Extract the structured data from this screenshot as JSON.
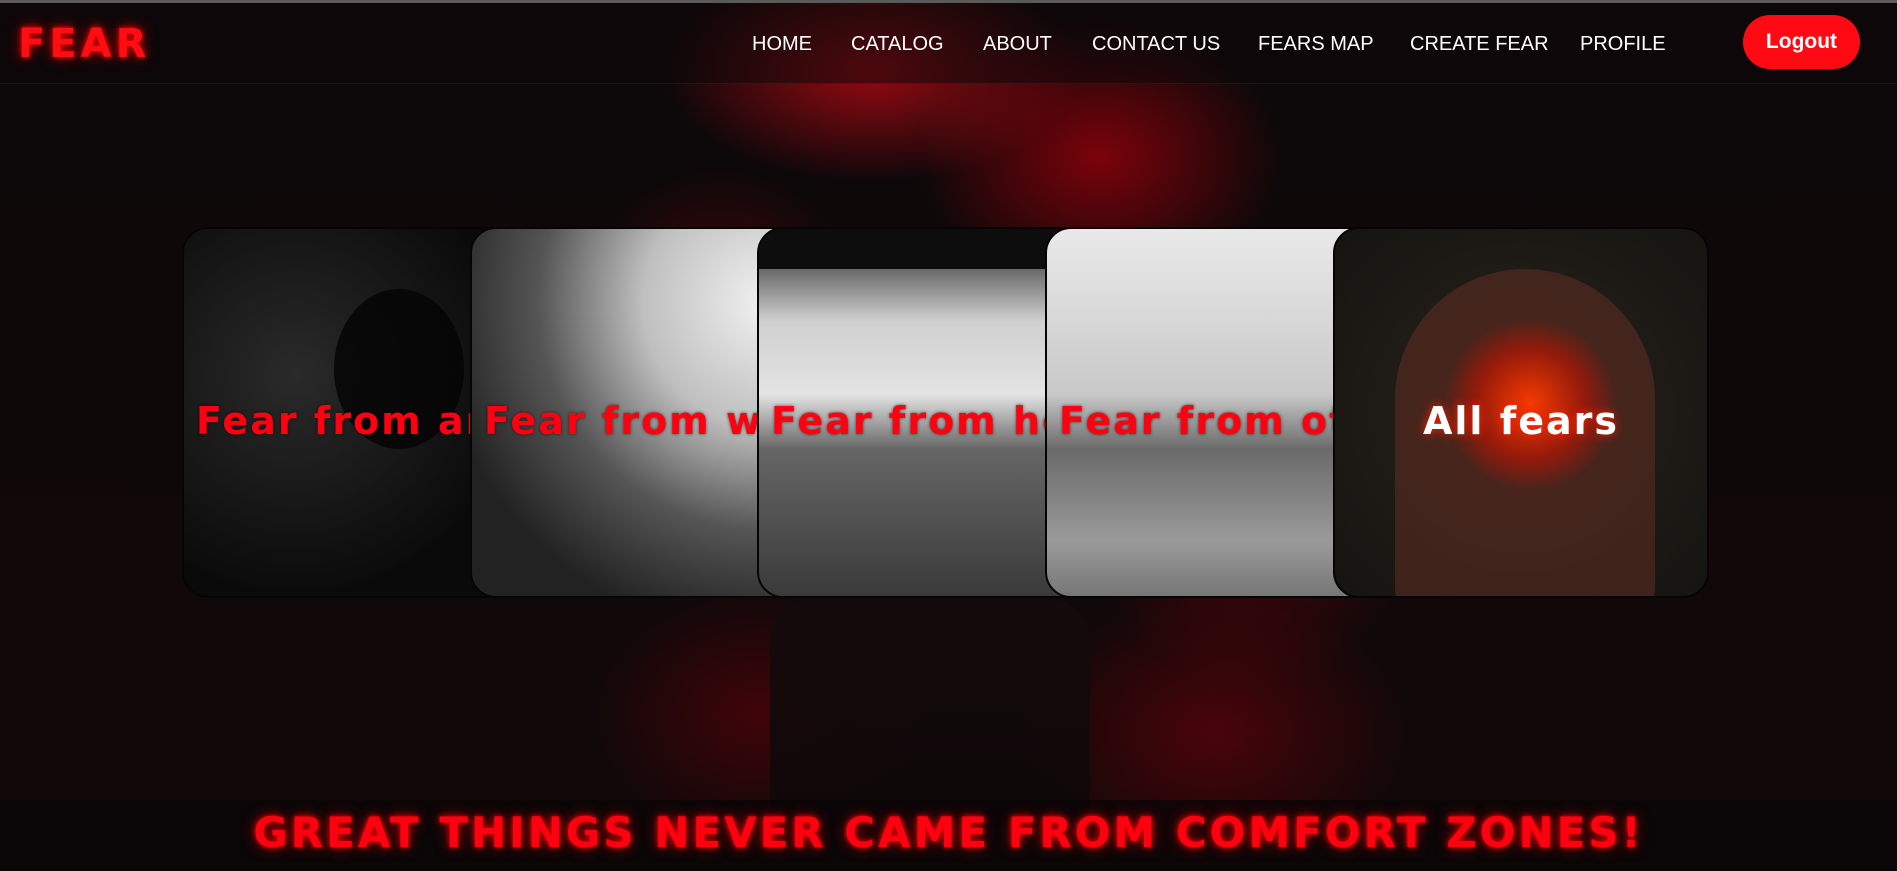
{
  "brand": {
    "logo_text": "FEAR",
    "accent": "#ff0a14"
  },
  "nav": {
    "items": [
      {
        "label": "HOME"
      },
      {
        "label": "CATALOG"
      },
      {
        "label": "ABOUT"
      },
      {
        "label": "CONTACT US"
      },
      {
        "label": "FEARS MAP"
      },
      {
        "label": "CREATE FEAR"
      },
      {
        "label": "PROFILE"
      }
    ],
    "logout_label": "Logout"
  },
  "cards": [
    {
      "label": "Fear from ani"
    },
    {
      "label": "Fear from wa"
    },
    {
      "label": "Fear from hei"
    },
    {
      "label": "Fear from oth"
    },
    {
      "label": "All fears"
    }
  ],
  "footer": {
    "motto": "GREAT THINGS NEVER CAME FROM COMFORT ZONES!"
  }
}
